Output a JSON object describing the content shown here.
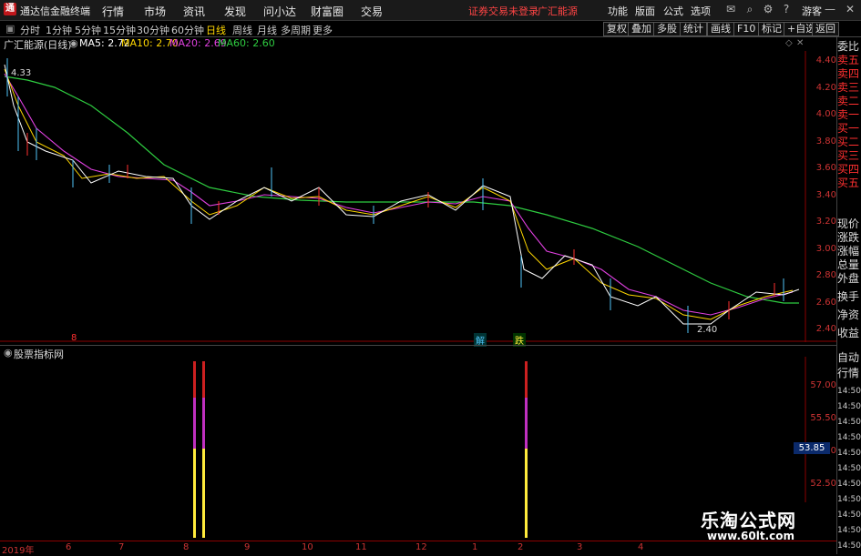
{
  "titlebar": {
    "app_title": "通达信金融终端",
    "logo_text": "通",
    "menus": [
      "行情",
      "市场",
      "资讯",
      "发现",
      "问小达",
      "财富圈",
      "交易"
    ],
    "login_notice": "证券交易未登录",
    "stock_link": "广汇能源",
    "right_menus": [
      "功能",
      "版面",
      "公式",
      "选项"
    ],
    "user": "游客"
  },
  "toolbar": {
    "periods": [
      "分时",
      "1分钟",
      "5分钟",
      "15分钟",
      "30分钟",
      "60分钟",
      "日线",
      "周线",
      "月线",
      "多周期",
      "更多"
    ],
    "active_period": "日线",
    "right_buttons": [
      "复权",
      "叠加",
      "多股",
      "统计",
      "画线",
      "F10",
      "标记",
      "+自选",
      "返回"
    ]
  },
  "main_header": {
    "stock": "广汇能源(日线)",
    "ma5": "MA5: 2.72",
    "ma10": "MA10: 2.70",
    "ma20": "MA20: 2.69",
    "ma60": "MA60: 2.60"
  },
  "main_axis": [
    "4.40",
    "4.20",
    "4.00",
    "3.80",
    "3.60",
    "3.40",
    "3.20",
    "3.00",
    "2.80",
    "2.60",
    "2.40"
  ],
  "annotations": {
    "high": "4.33",
    "low": "2.40",
    "marker_left": "8",
    "marker_a": "解",
    "marker_b": "跌"
  },
  "sub_header": {
    "indicator": "股票指标网"
  },
  "sub_axis": [
    "57.00",
    "55.50",
    "54.00",
    "52.50"
  ],
  "sub_current": "53.85",
  "side_panel": [
    "委比",
    "卖五",
    "卖四",
    "卖三",
    "卖二",
    "卖一",
    "买一",
    "买二",
    "买三",
    "买四",
    "买五",
    "现价",
    "涨跌",
    "涨幅",
    "总量",
    "外盘",
    "换手",
    "净资",
    "收益"
  ],
  "side_panel_lower": [
    "自动",
    "行情",
    "14:50",
    "14:50",
    "14:50",
    "14:50",
    "14:50",
    "14:50",
    "14:50",
    "14:50",
    "14:50",
    "14:50",
    "14:50"
  ],
  "date_axis": [
    "2019年",
    "6",
    "7",
    "8",
    "9",
    "10",
    "11",
    "12",
    "1",
    "2",
    "3",
    "4"
  ],
  "watermark": {
    "cn": "乐淘公式网",
    "url": "www.60lt.com"
  },
  "colors": {
    "ma5": "#ffffff",
    "ma10": "#ffd700",
    "ma20": "#e040e0",
    "ma60": "#2ecc40",
    "axis": "#cc3333"
  }
}
